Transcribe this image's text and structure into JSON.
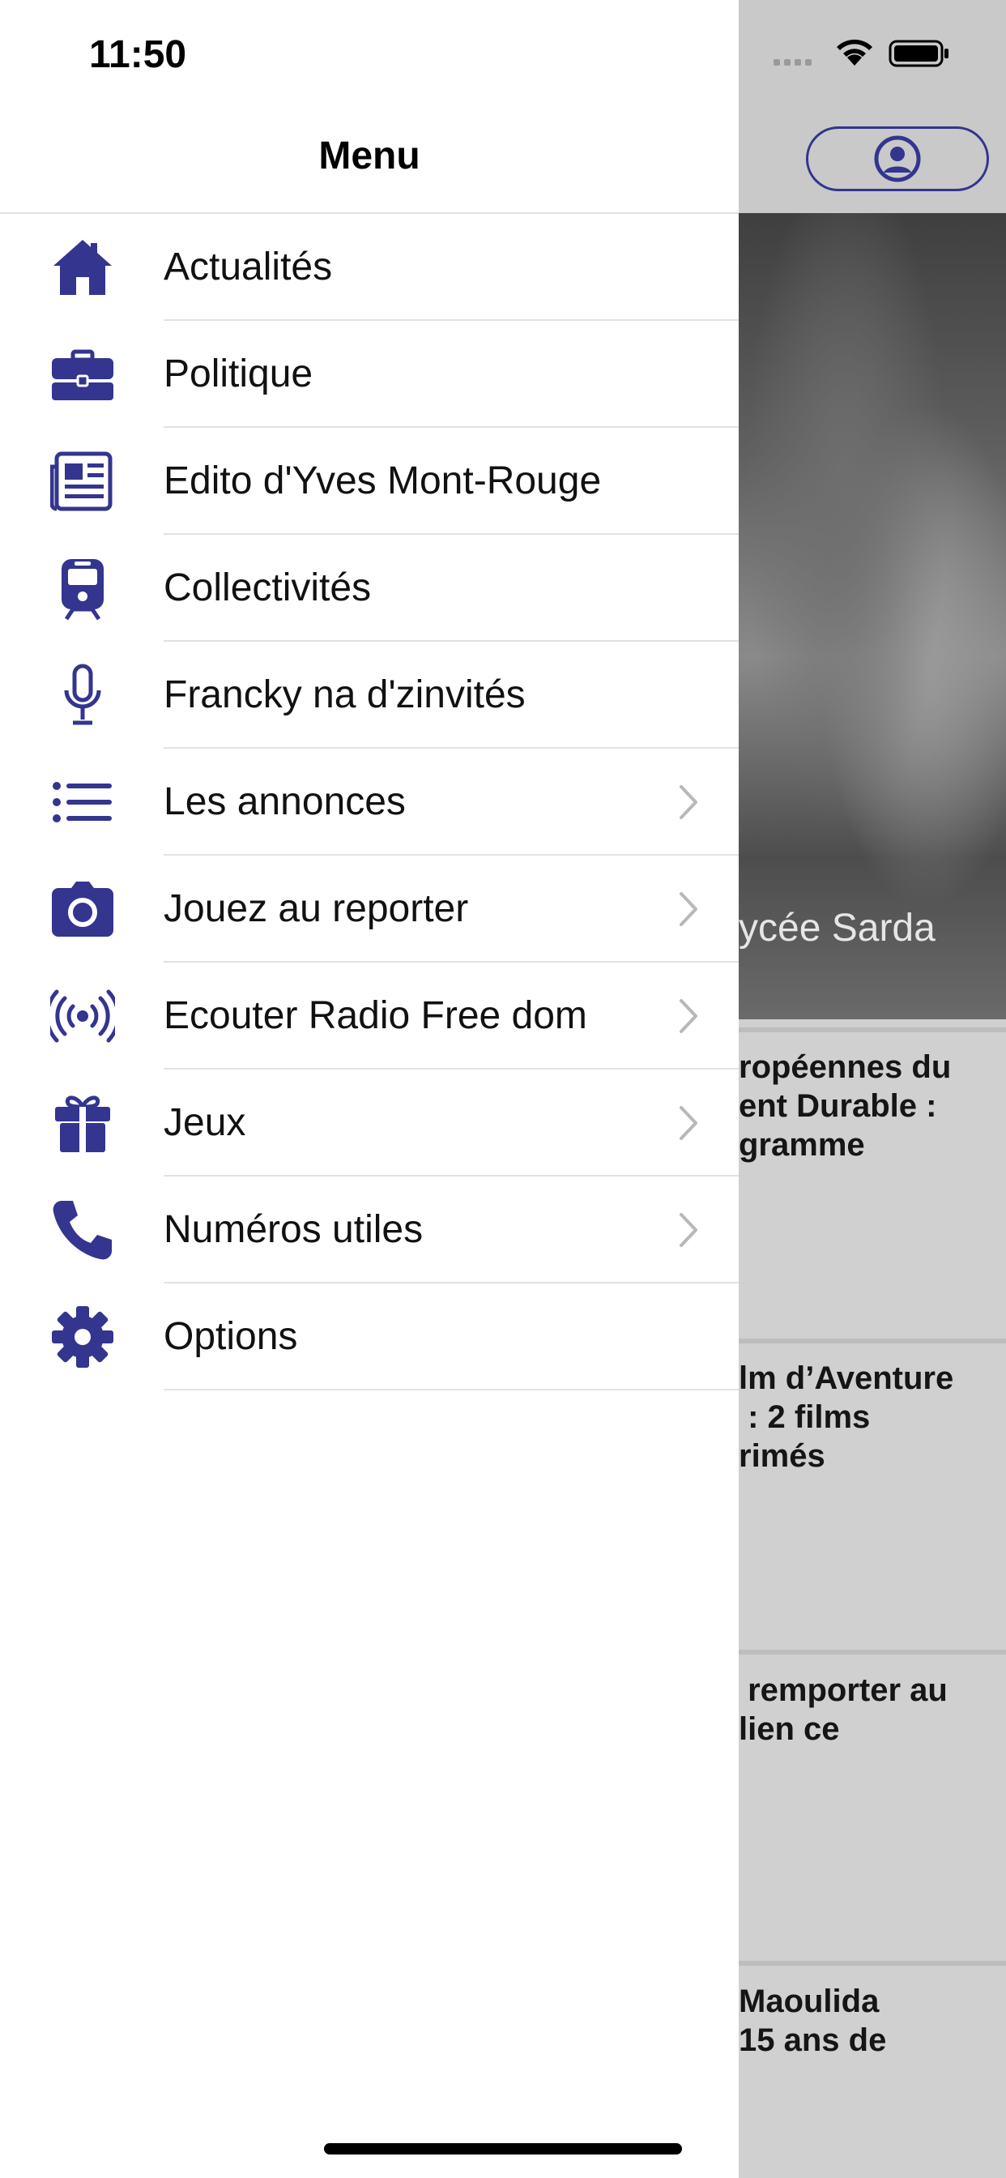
{
  "status_bar": {
    "time": "11:50"
  },
  "drawer": {
    "title": "Menu",
    "items": [
      {
        "label": "Actualités",
        "icon": "home-icon",
        "has_chevron": false
      },
      {
        "label": "Politique",
        "icon": "briefcase-icon",
        "has_chevron": false
      },
      {
        "label": "Edito d'Yves Mont-Rouge",
        "icon": "newspaper-icon",
        "has_chevron": false
      },
      {
        "label": "Collectivités",
        "icon": "train-icon",
        "has_chevron": false
      },
      {
        "label": "Francky na d'zinvités",
        "icon": "microphone-icon",
        "has_chevron": false
      },
      {
        "label": "Les annonces",
        "icon": "list-icon",
        "has_chevron": true
      },
      {
        "label": "Jouez au reporter",
        "icon": "camera-icon",
        "has_chevron": true
      },
      {
        "label": "Ecouter Radio Free dom",
        "icon": "broadcast-icon",
        "has_chevron": true
      },
      {
        "label": "Jeux",
        "icon": "gift-icon",
        "has_chevron": true
      },
      {
        "label": "Numéros utiles",
        "icon": "phone-icon",
        "has_chevron": true
      },
      {
        "label": "Options",
        "icon": "gear-icon",
        "has_chevron": false
      }
    ]
  },
  "background": {
    "hero_caption": "ycée Sarda",
    "articles": [
      "ropéennes du\nent Durable :\ngramme",
      "lm d’Aventure\n : 2 films\nrimés",
      " remporter au\nlien ce",
      "Maoulida\n15 ans de"
    ]
  },
  "colors": {
    "accent": "#33358f",
    "chevron": "#b8b8b8"
  }
}
